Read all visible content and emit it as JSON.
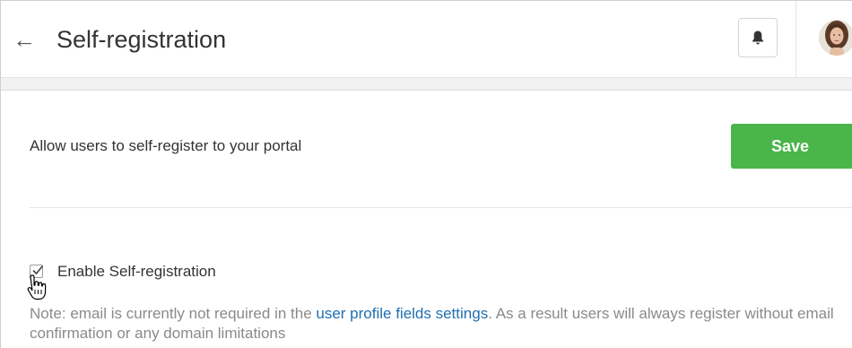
{
  "header": {
    "back_icon": "arrow-left-icon",
    "title": "Self-registration",
    "notification_icon": "bell-icon",
    "avatar_icon": "user-avatar"
  },
  "settings": {
    "description": "Allow users to self-register to your portal",
    "save_label": "Save",
    "save_color": "#4ab54a",
    "enable_checkbox": {
      "label": "Enable Self-registration",
      "checked": true
    },
    "note": {
      "prefix": "Note: email is currently not required in the ",
      "link_text": "user profile fields settings",
      "suffix": ". As a result users will always register without email confirmation or any domain limitations",
      "link_color": "#1f6fb2"
    }
  },
  "cursor": {
    "type": "hand-pointer-icon"
  }
}
